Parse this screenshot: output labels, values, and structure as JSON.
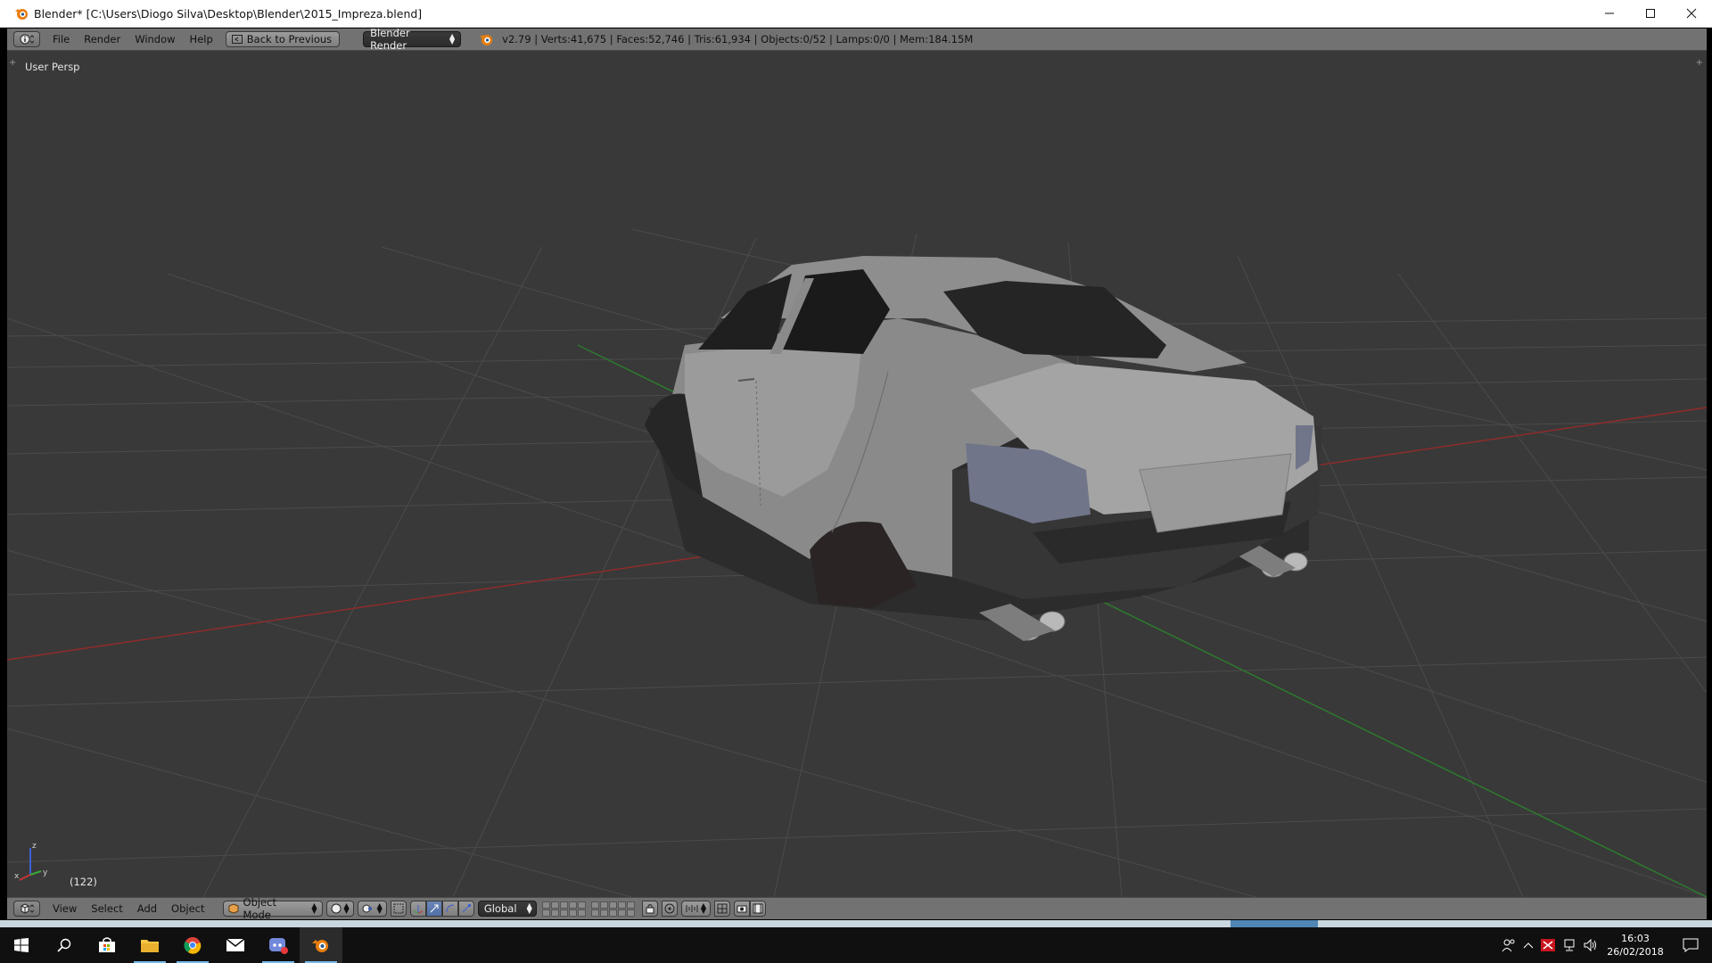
{
  "window": {
    "title": "Blender* [C:\\Users\\Diogo Silva\\Desktop\\Blender\\2015_Impreza.blend]",
    "icon": "blender-icon",
    "controls": [
      "minimize-icon",
      "maximize-icon",
      "close-icon"
    ]
  },
  "info_header": {
    "editor_icon": "info-icon",
    "menus": [
      "File",
      "Render",
      "Window",
      "Help"
    ],
    "back_button": "Back to Previous",
    "render_engine": "Blender Render",
    "stats": "v2.79 | Verts:41,675 | Faces:52,746 | Tris:61,934 | Objects:0/52 | Lamps:0/0 | Mem:184.15M"
  },
  "viewport": {
    "view_label": "User Persp",
    "frame_label": "(122)",
    "axis_labels": {
      "x": "x",
      "y": "y",
      "z": "z"
    },
    "background": "#393939",
    "grid_color": "#4b4b4b",
    "x_axis_color": "#8e2b2b",
    "y_axis_color": "#2d7a2d"
  },
  "view_header": {
    "editor_icon": "3d-view-icon",
    "menus": [
      "View",
      "Select",
      "Add",
      "Object"
    ],
    "mode": "Object Mode",
    "orientation": "Global"
  },
  "taskbar": {
    "apps": [
      "start-icon",
      "search-icon",
      "store-icon",
      "file-explorer-icon",
      "chrome-icon",
      "mail-icon",
      "discord-icon",
      "blender-icon"
    ],
    "time": "16:03",
    "date": "26/02/2018"
  }
}
